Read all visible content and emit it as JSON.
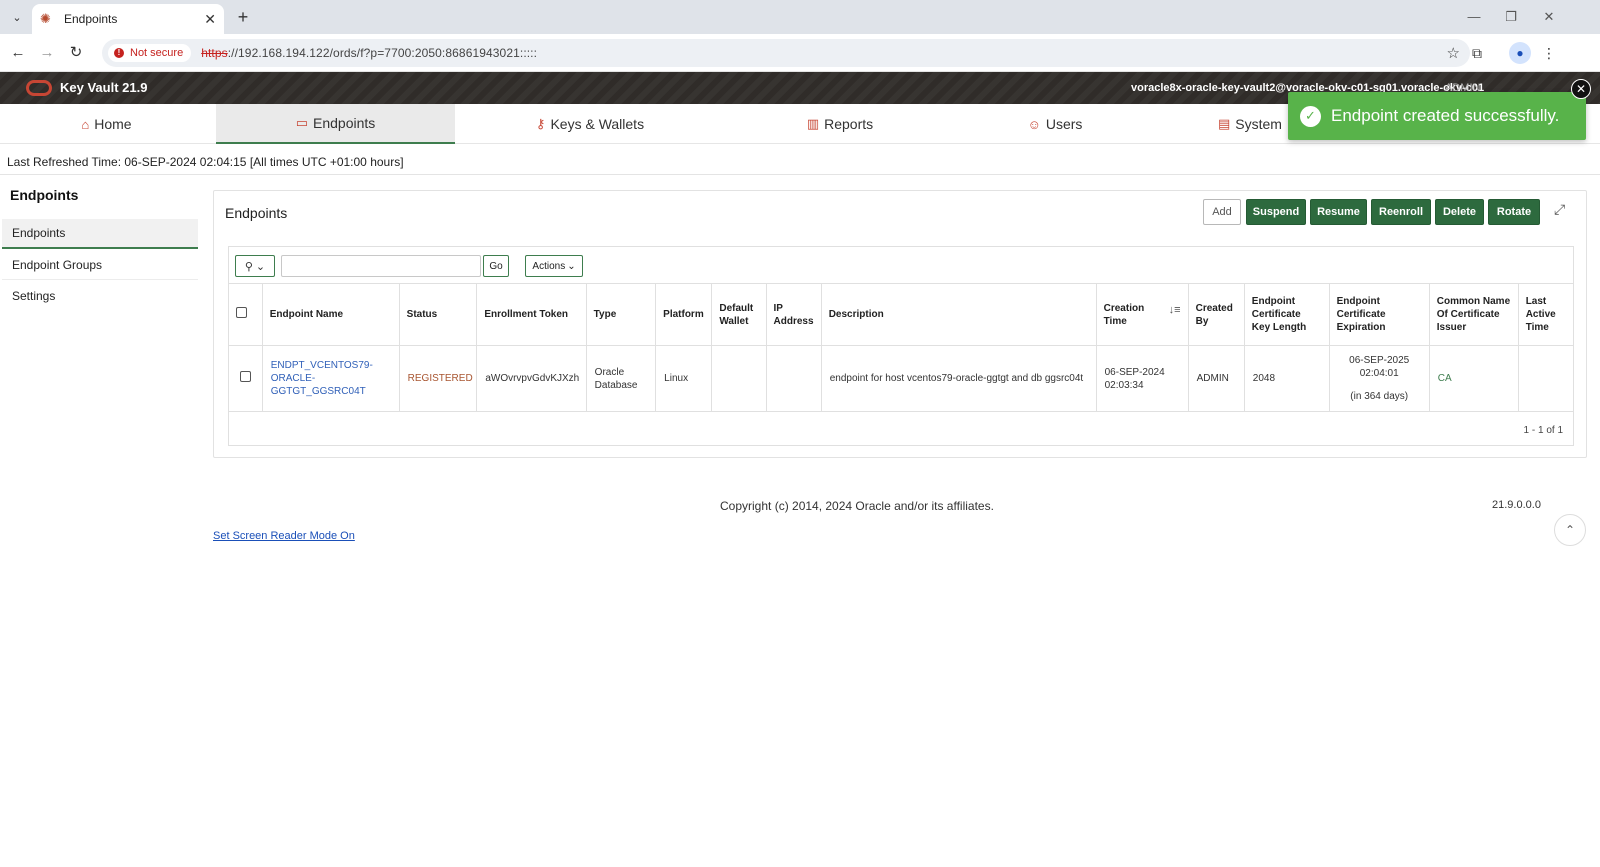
{
  "browser": {
    "tab_title": "Endpoints",
    "not_secure": "Not secure",
    "url_scheme": "https",
    "url_rest": "://192.168.194.122/ords/f?p=7700:2050:86861943021:::::"
  },
  "header": {
    "app_title": "Key Vault 21.9",
    "user": "voracle8x-oracle-key-vault2@voracle-okv-c01-sg01.voracle-okv-c01",
    "admin": "ADMIN"
  },
  "nav": {
    "tabs": [
      {
        "label": "Home",
        "icon": "home-icon"
      },
      {
        "label": "Endpoints",
        "icon": "monitor-icon"
      },
      {
        "label": "Keys & Wallets",
        "icon": "key-icon"
      },
      {
        "label": "Reports",
        "icon": "bar-chart-icon"
      },
      {
        "label": "Users",
        "icon": "users-icon"
      },
      {
        "label": "System",
        "icon": "system-icon"
      }
    ]
  },
  "refresh_time": "Last Refreshed Time: 06-SEP-2024 02:04:15 [All times UTC +01:00 hours]",
  "sidebar": {
    "title": "Endpoints",
    "items": [
      "Endpoints",
      "Endpoint Groups",
      "Settings"
    ]
  },
  "region": {
    "title": "Endpoints",
    "buttons": {
      "add": "Add",
      "suspend": "Suspend",
      "resume": "Resume",
      "reenroll": "Reenroll",
      "delete": "Delete",
      "rotate": "Rotate"
    },
    "go": "Go",
    "actions": "Actions",
    "columns": [
      "Endpoint Name",
      "Status",
      "Enrollment Token",
      "Type",
      "Platform",
      "Default Wallet",
      "IP Address",
      "Description",
      "Creation Time",
      "Created By",
      "Endpoint Certificate Key Length",
      "Endpoint Certificate Expiration",
      "Common Name Of Certificate Issuer",
      "Last Active Time"
    ],
    "rows": [
      {
        "name": "ENDPT_VCENTOS79-ORACLE-GGTGT_GGSRC04T",
        "status": "REGISTERED",
        "token": "aWOvrvpvGdvKJXzh",
        "type": "Oracle Database",
        "platform": "Linux",
        "wallet": "",
        "ip": "",
        "description": "endpoint for host vcentos79-oracle-ggtgt and db ggsrc04t",
        "creation_time": "06-SEP-2024 02:03:34",
        "created_by": "ADMIN",
        "key_length": "2048",
        "expiration": "06-SEP-2025 02:04:01",
        "expiration_days": "(in 364 days)",
        "issuer": "CA",
        "last_active": ""
      }
    ],
    "pager": "1 - 1 of 1"
  },
  "footer": {
    "copyright": "Copyright (c) 2014, 2024 Oracle and/or its affiliates.",
    "version": "21.9.0.0.0",
    "screen_reader": "Set Screen Reader Mode On"
  },
  "toast": {
    "message": "Endpoint created successfully."
  },
  "colors": {
    "accent_green": "#2d6a3e",
    "toast_green": "#58b34a",
    "header_bg": "#312d2a",
    "oracle_red": "#c74634"
  }
}
